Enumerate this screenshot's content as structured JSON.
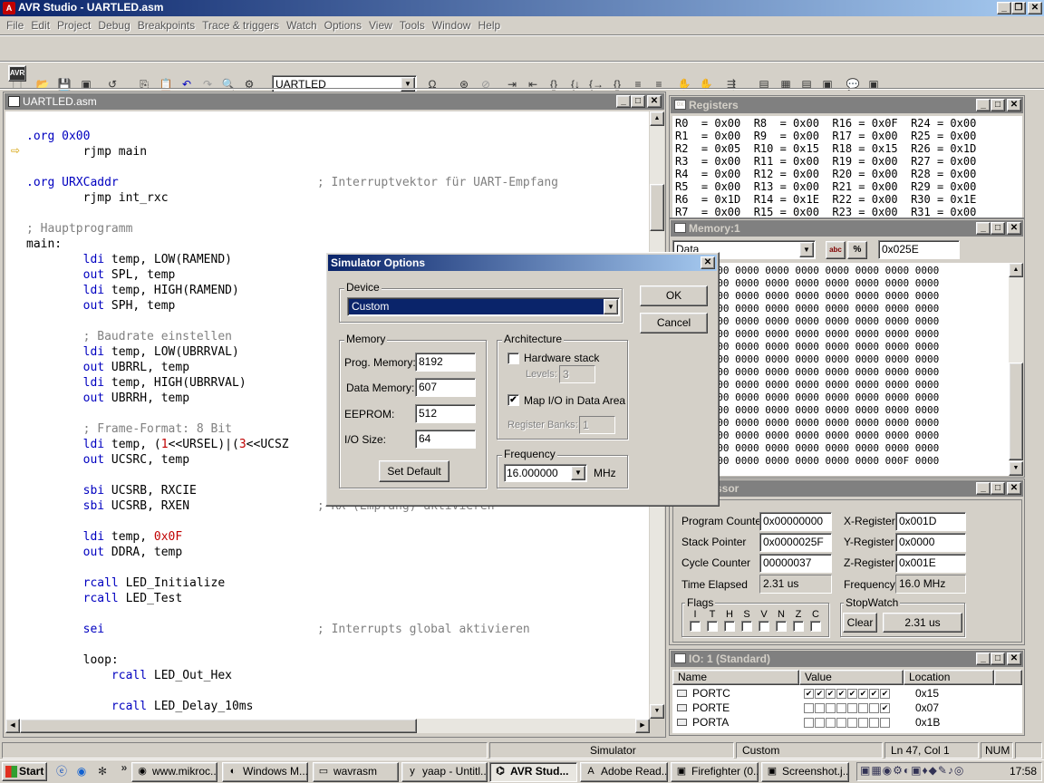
{
  "app": {
    "title": "AVR Studio - UARTLED.asm",
    "menus": [
      "File",
      "Edit",
      "Project",
      "Debug",
      "Breakpoints",
      "Trace & triggers",
      "Watch",
      "Options",
      "View",
      "Tools",
      "Window",
      "Help"
    ],
    "project_combo": "UARTLED"
  },
  "editor": {
    "title": "UARTLED.asm",
    "lines": [
      {
        "t": ".org 0x00",
        "c": "kw"
      },
      {
        "t": "        rjmp main",
        "c": ""
      },
      {
        "t": "",
        "c": ""
      },
      {
        "t": ".org URXCaddr                            ; Interruptvektor für UART-Empfang",
        "c": "mix1"
      },
      {
        "t": "        rjmp int_rxc",
        "c": ""
      },
      {
        "t": "",
        "c": ""
      },
      {
        "t": "; Hauptprogramm",
        "c": "cm"
      },
      {
        "t": "main:",
        "c": ""
      },
      {
        "t": "        ldi temp, LOW(RAMEND)",
        "c": "ldi"
      },
      {
        "t": "        out SPL, temp",
        "c": "out"
      },
      {
        "t": "        ldi temp, HIGH(RAMEND)",
        "c": "ldi"
      },
      {
        "t": "        out SPH, temp",
        "c": "out"
      },
      {
        "t": "",
        "c": ""
      },
      {
        "t": "        ; Baudrate einstellen",
        "c": "cm"
      },
      {
        "t": "        ldi temp, LOW(UBRRVAL)",
        "c": "ldi"
      },
      {
        "t": "        out UBRRL, temp",
        "c": "out"
      },
      {
        "t": "        ldi temp, HIGH(UBRRVAL)",
        "c": "ldi"
      },
      {
        "t": "        out UBRRH, temp",
        "c": "out"
      },
      {
        "t": "",
        "c": ""
      },
      {
        "t": "        ; Frame-Format: 8 Bit",
        "c": "cm"
      },
      {
        "t": "        ldi temp, (1<<URSEL)|(3<<UCSZ",
        "c": "ldi"
      },
      {
        "t": "        out UCSRC, temp",
        "c": "out"
      },
      {
        "t": "",
        "c": ""
      },
      {
        "t": "        sbi UCSRB, RXCIE",
        "c": "sbi"
      },
      {
        "t": "        sbi UCSRB, RXEN                  ; RX (Empfang) aktivieren",
        "c": "sbi"
      },
      {
        "t": "",
        "c": ""
      },
      {
        "t": "        ldi temp, 0x0F",
        "c": "ldi"
      },
      {
        "t": "        out DDRA, temp",
        "c": "out"
      },
      {
        "t": "",
        "c": ""
      },
      {
        "t": "        rcall LED_Initialize",
        "c": "rc"
      },
      {
        "t": "        rcall LED_Test",
        "c": "rc"
      },
      {
        "t": "",
        "c": ""
      },
      {
        "t": "        sei                              ; Interrupts global aktivieren",
        "c": "sei"
      },
      {
        "t": "",
        "c": ""
      },
      {
        "t": "        loop:",
        "c": ""
      },
      {
        "t": "            rcall LED_Out_Hex",
        "c": "rc"
      },
      {
        "t": "",
        "c": ""
      },
      {
        "t": "            rcall LED_Delay_10ms",
        "c": "rc"
      }
    ]
  },
  "registers": {
    "title": "Registers",
    "rows": [
      "R0  = 0x00  R8  = 0x00  R16 = 0x0F  R24 = 0x00",
      "R1  = 0x00  R9  = 0x00  R17 = 0x00  R25 = 0x00",
      "R2  = 0x05  R10 = 0x15  R18 = 0x15  R26 = 0x1D",
      "R3  = 0x00  R11 = 0x00  R19 = 0x00  R27 = 0x00",
      "R4  = 0x00  R12 = 0x00  R20 = 0x00  R28 = 0x00",
      "R5  = 0x00  R13 = 0x00  R21 = 0x00  R29 = 0x00",
      "R6  = 0x1D  R14 = 0x1E  R22 = 0x00  R30 = 0x1E",
      "R7  = 0x00  R15 = 0x00  R23 = 0x00  R31 = 0x00"
    ]
  },
  "memory": {
    "title": "Memory:1",
    "type": "Data",
    "address": "0x025E",
    "rows": [
      "0000 0000 0000 0000 0000 0000 0000 0000",
      "0000 0000 0000 0000 0000 0000 0000 0000",
      "0000 0000 0000 0000 0000 0000 0000 0000",
      "0000 0000 0000 0000 0000 0000 0000 0000",
      "0000 0000 0000 0000 0000 0000 0000 0000",
      "0000 0000 0000 0000 0000 0000 0000 0000",
      "0000 0000 0000 0000 0000 0000 0000 0000",
      "0000 0000 0000 0000 0000 0000 0000 0000",
      "0000 0000 0000 0000 0000 0000 0000 0000",
      "0000 0000 0000 0000 0000 0000 0000 0000",
      "0000 0000 0000 0000 0000 0000 0000 0000",
      "0000 0000 0000 0000 0000 0000 0000 0000",
      "0000 0000 0000 0000 0000 0000 0000 0000",
      "0000 0000 0000 0000 0000 0000 0000 0000",
      "0000 0000 0000 0000 0000 0000 0000 0000",
      "0000 0000 0000 0000 0000 0000 000F 0000"
    ]
  },
  "processor": {
    "title": "ssor",
    "program_counter_label": "Program Counter",
    "program_counter": "0x00000000",
    "stack_pointer_label": "Stack Pointer",
    "stack_pointer": "0x0000025F",
    "cycle_counter_label": "Cycle Counter",
    "cycle_counter": "00000037",
    "time_elapsed_label": "Time Elapsed",
    "time_elapsed": "2.31 us",
    "x_register_label": "X-Register",
    "x_register": "0x001D",
    "y_register_label": "Y-Register",
    "y_register": "0x0000",
    "z_register_label": "Z-Register",
    "z_register": "0x001E",
    "frequency_label": "Frequency",
    "frequency": "16.0 MHz",
    "flags_label": "Flags",
    "flags": [
      "I",
      "T",
      "H",
      "S",
      "V",
      "N",
      "Z",
      "C"
    ],
    "stopwatch_label": "StopWatch",
    "clear_label": "Clear",
    "stopwatch_value": "2.31 us"
  },
  "io": {
    "title": "IO: 1 (Standard)",
    "headers": [
      "Name",
      "Value",
      "Location"
    ],
    "rows": [
      {
        "name": "PORTC",
        "bits": [
          1,
          1,
          1,
          1,
          1,
          1,
          1,
          1
        ],
        "loc": "0x15"
      },
      {
        "name": "PORTE",
        "bits": [
          0,
          0,
          0,
          0,
          0,
          0,
          0,
          1
        ],
        "loc": "0x07"
      },
      {
        "name": "PORTA",
        "bits": [
          0,
          0,
          0,
          0,
          0,
          0,
          0,
          0
        ],
        "loc": "0x1B"
      }
    ]
  },
  "dialog": {
    "title": "Simulator Options",
    "device_group": "Device",
    "device_value": "Custom",
    "ok": "OK",
    "cancel": "Cancel",
    "memory_group": "Memory",
    "prog_memory_label": "Prog. Memory:",
    "prog_memory": "8192",
    "data_memory_label": "Data Memory:",
    "data_memory": "607",
    "eeprom_label": "EEPROM:",
    "eeprom": "512",
    "io_size_label": "I/O Size:",
    "io_size": "64",
    "set_default": "Set Default",
    "arch_group": "Architecture",
    "hardware_stack": "Hardware stack",
    "levels_label": "Levels:",
    "levels": "3",
    "map_io": "Map I/O in Data Area",
    "register_banks_label": "Register Banks:",
    "register_banks": "1",
    "frequency_group": "Frequency",
    "frequency_value": "16.000000",
    "frequency_unit": "MHz"
  },
  "statusbar": {
    "mode": "Simulator",
    "device": "Custom",
    "position": "Ln 47, Col 1",
    "num": "NUM"
  },
  "taskbar": {
    "start": "Start",
    "tasks": [
      "www.mikroc...",
      "Windows M...",
      "wavrasm",
      "yaap - Untitl...",
      "AVR Stud...",
      "Adobe Read...",
      "Firefighter (0...",
      "Screenshot.j..."
    ],
    "clock": "17:58"
  }
}
